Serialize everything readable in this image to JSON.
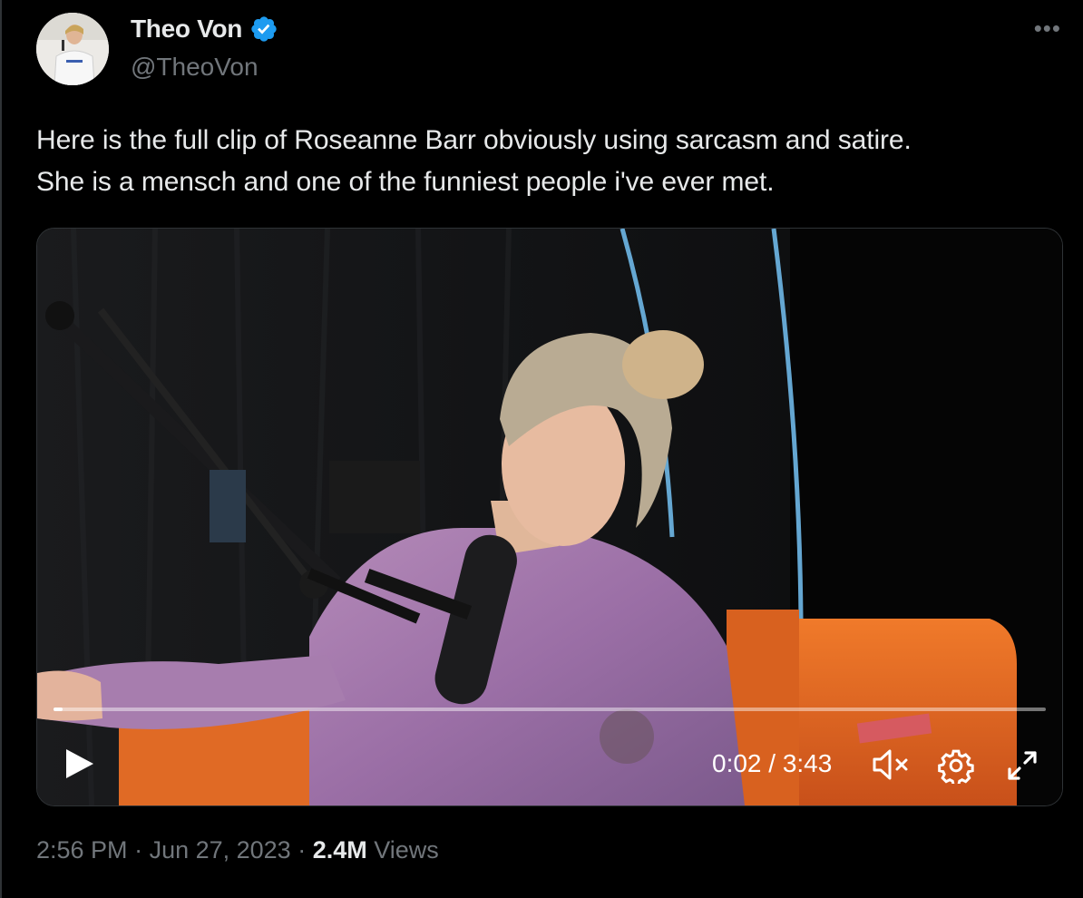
{
  "author": {
    "display_name": "Theo Von",
    "handle": "@TheoVon",
    "avatar_icon": "profile-photo",
    "verified_icon": "verified-badge-icon",
    "verified_color": "#1d9bf0"
  },
  "more_icon": "more-options-icon",
  "tweet": {
    "text": "Here is the full clip of Roseanne Barr obviously using sarcasm and satire.\nShe is a mensch and one of the funniest people i've ever met."
  },
  "video": {
    "progress_fraction": 0.009,
    "time_display": "0:02 / 3:43",
    "play_icon": "play-icon",
    "mute_icon": "muted-speaker-icon",
    "settings_icon": "gear-icon",
    "fullscreen_icon": "fullscreen-icon"
  },
  "meta": {
    "time": "2:56 PM",
    "separator": " · ",
    "date": "Jun 27, 2023",
    "views_count": "2.4M",
    "views_label": "Views"
  }
}
